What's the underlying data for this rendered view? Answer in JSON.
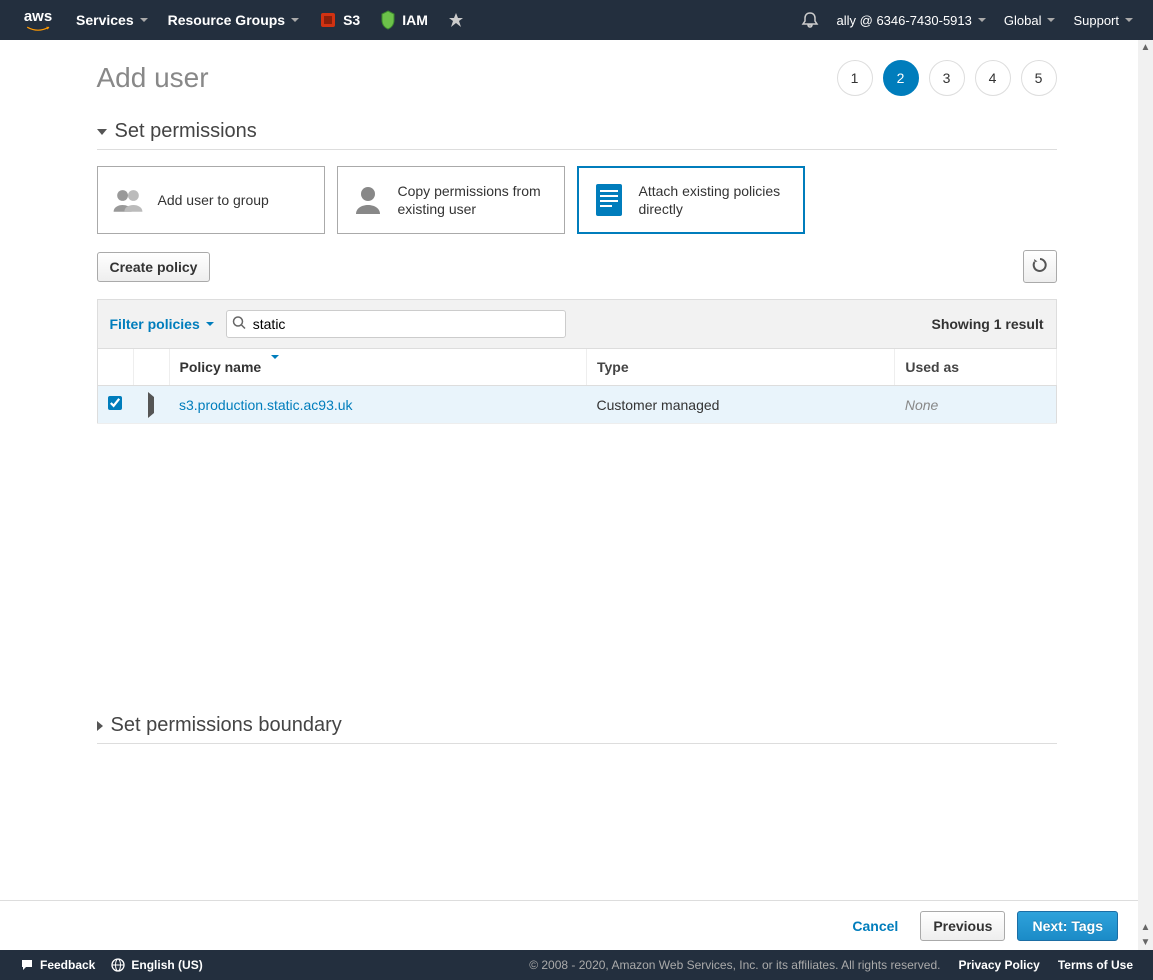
{
  "nav": {
    "logo_text": "aws",
    "services": "Services",
    "resource_groups": "Resource Groups",
    "shortcuts": [
      {
        "label": "S3",
        "icon": "s3"
      },
      {
        "label": "IAM",
        "icon": "iam"
      }
    ],
    "account": "ally @ 6346-7430-5913",
    "region": "Global",
    "support": "Support"
  },
  "page": {
    "title": "Add user",
    "steps": [
      "1",
      "2",
      "3",
      "4",
      "5"
    ],
    "active_step_index": 1
  },
  "permissions": {
    "section_title": "Set permissions",
    "options": [
      {
        "label": "Add user to group",
        "icon": "group"
      },
      {
        "label": "Copy permissions from existing user",
        "icon": "user"
      },
      {
        "label": "Attach existing policies directly",
        "icon": "doc"
      }
    ],
    "selected_option_index": 2,
    "create_policy": "Create policy",
    "filter_label": "Filter policies",
    "search_value": "static",
    "result_count": "Showing 1 result",
    "columns": {
      "name": "Policy name",
      "type": "Type",
      "used_as": "Used as"
    },
    "rows": [
      {
        "checked": true,
        "name": "s3.production.static.ac93.uk",
        "type": "Customer managed",
        "used_as": "None"
      }
    ]
  },
  "boundary": {
    "section_title": "Set permissions boundary"
  },
  "actions": {
    "cancel": "Cancel",
    "previous": "Previous",
    "next": "Next: Tags"
  },
  "footer": {
    "feedback": "Feedback",
    "language": "English (US)",
    "copyright": "© 2008 - 2020, Amazon Web Services, Inc. or its affiliates. All rights reserved.",
    "privacy": "Privacy Policy",
    "terms": "Terms of Use"
  }
}
